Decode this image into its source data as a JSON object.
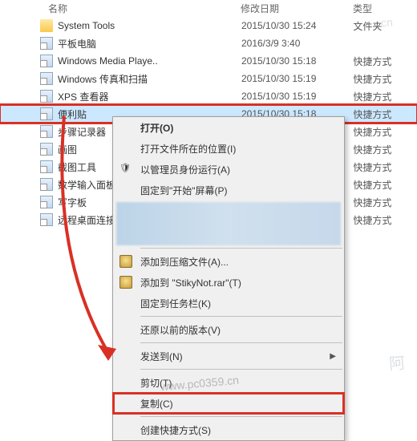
{
  "header": {
    "name": "名称",
    "date": "修改日期",
    "type": "类型"
  },
  "files": [
    {
      "icon": "folder",
      "name": "System Tools",
      "date": "2015/10/30 15:24",
      "type": "文件夹"
    },
    {
      "icon": "shortcut",
      "name": "平板电脑",
      "date": "2016/3/9 3:40",
      "type": ""
    },
    {
      "icon": "shortcut",
      "name": "Windows Media Playe..",
      "date": "2015/10/30 15:18",
      "type": "快捷方式"
    },
    {
      "icon": "shortcut",
      "name": "Windows 传真和扫描",
      "date": "2015/10/30 15:19",
      "type": "快捷方式"
    },
    {
      "icon": "shortcut",
      "name": "XPS 查看器",
      "date": "2015/10/30 15:19",
      "type": "快捷方式"
    },
    {
      "icon": "shortcut",
      "name": "便利贴",
      "date": "2015/10/30 15:18",
      "type": "快捷方式",
      "selected": true,
      "highlight": true
    },
    {
      "icon": "shortcut",
      "name": "步骤记录器",
      "date": "",
      "type": "快捷方式"
    },
    {
      "icon": "shortcut",
      "name": "画图",
      "date": "",
      "type": "快捷方式"
    },
    {
      "icon": "shortcut",
      "name": "截图工具",
      "date": "",
      "type": "快捷方式"
    },
    {
      "icon": "shortcut",
      "name": "数学输入面板",
      "date": "",
      "type": "快捷方式"
    },
    {
      "icon": "shortcut",
      "name": "写字板",
      "date": "",
      "type": "快捷方式"
    },
    {
      "icon": "shortcut",
      "name": "远程桌面连接",
      "date": "",
      "type": "快捷方式"
    }
  ],
  "menu": [
    {
      "kind": "item",
      "label": "打开(O)",
      "bold": true
    },
    {
      "kind": "item",
      "label": "打开文件所在的位置(I)"
    },
    {
      "kind": "item",
      "label": "以管理员身份运行(A)",
      "icon": "admin"
    },
    {
      "kind": "item",
      "label": "固定到\"开始\"屏幕(P)"
    },
    {
      "kind": "blur"
    },
    {
      "kind": "sep"
    },
    {
      "kind": "item",
      "label": "添加到压缩文件(A)...",
      "icon": "winrar"
    },
    {
      "kind": "item",
      "label": "添加到 \"StikyNot.rar\"(T)",
      "icon": "winrar"
    },
    {
      "kind": "item",
      "label": "固定到任务栏(K)"
    },
    {
      "kind": "sep"
    },
    {
      "kind": "item",
      "label": "还原以前的版本(V)"
    },
    {
      "kind": "sep"
    },
    {
      "kind": "item",
      "label": "发送到(N)",
      "arrow": true
    },
    {
      "kind": "sep"
    },
    {
      "kind": "item",
      "label": "剪切(T)"
    },
    {
      "kind": "item",
      "label": "复制(C)",
      "highlight": true
    },
    {
      "kind": "sep"
    },
    {
      "kind": "item",
      "label": "创建快捷方式(S)"
    }
  ],
  "watermarks": {
    "w1": ".cn",
    "w2": "阿",
    "w3": "www.pc0359.cn"
  }
}
